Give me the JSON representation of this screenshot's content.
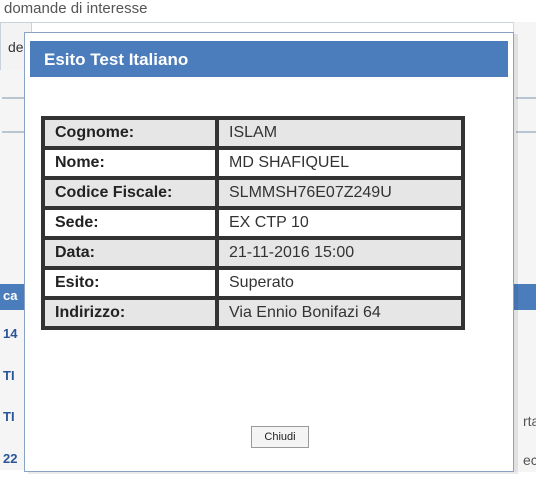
{
  "background": {
    "header_text": "domande di interesse",
    "left_text_top": "de",
    "left_labels": [
      "ca",
      "14",
      "TI",
      "TI",
      "22"
    ],
    "right_labels": [
      "rta",
      "ec"
    ]
  },
  "modal": {
    "title": "Esito Test Italiano",
    "rows": [
      {
        "label": "Cognome:",
        "value": "ISLAM"
      },
      {
        "label": "Nome:",
        "value": "MD SHAFIQUEL"
      },
      {
        "label": "Codice Fiscale:",
        "value": "SLMMSH76E07Z249U"
      },
      {
        "label": "Sede:",
        "value": "EX CTP 10"
      },
      {
        "label": "Data:",
        "value": "21-11-2016 15:00"
      },
      {
        "label": "Esito:",
        "value": "Superato"
      },
      {
        "label": "Indirizzo:",
        "value": "Via Ennio Bonifazi 64"
      }
    ],
    "close_label": "Chiudi"
  },
  "colors": {
    "accent": "#4b7dbd",
    "grey_row": "#e6e6e6",
    "border": "#333333"
  }
}
